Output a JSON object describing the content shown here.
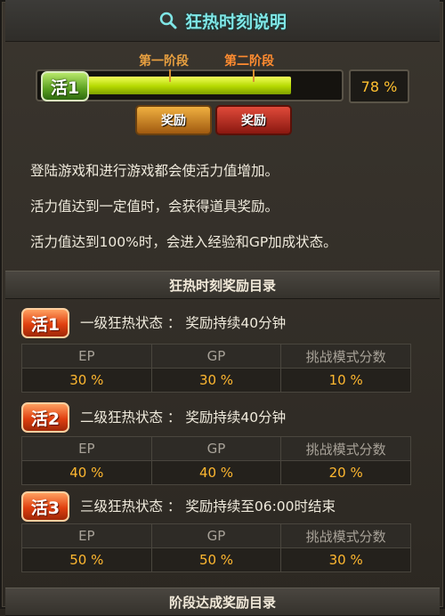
{
  "title": "狂热时刻说明",
  "stages": [
    "第一阶段",
    "第二阶段"
  ],
  "vitality": {
    "badge": "活1",
    "percent_text": "78 %",
    "fill": 0.78
  },
  "rewards": [
    "奖励",
    "奖励"
  ],
  "description": [
    "登陆游戏和进行游戏都会使活力值增加。",
    "活力值达到一定值时，会获得道具奖励。",
    "活力值达到100%时，会进入经验和GP加成状态。"
  ],
  "section1": "狂热时刻奖励目录",
  "columns": [
    "EP",
    "GP",
    "挑战模式分数"
  ],
  "tiers": [
    {
      "badge": "活1",
      "text": "一级狂热状态 ： 奖励持续40分钟",
      "values": [
        "30 %",
        "30 %",
        "10 %"
      ]
    },
    {
      "badge": "活2",
      "text": "二级狂热状态 ： 奖励持续40分钟",
      "values": [
        "40 %",
        "40 %",
        "20 %"
      ]
    },
    {
      "badge": "活3",
      "text": "三级狂热状态 ： 奖励持续至06:00时结束",
      "values": [
        "50 %",
        "50 %",
        "30 %"
      ]
    }
  ],
  "section2": "阶段达成奖励目录",
  "colors": {
    "title": "#7fe6e6",
    "value": "#ffb830",
    "bar": "#c8e020"
  }
}
